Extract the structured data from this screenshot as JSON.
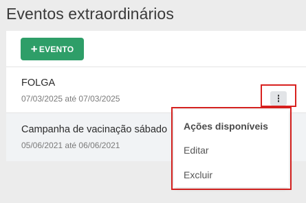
{
  "page": {
    "title": "Eventos extraordinários"
  },
  "toolbar": {
    "add_button_icon": "plus-icon",
    "add_button_label": "EVENTO",
    "accent_color": "#2e9e68"
  },
  "events": [
    {
      "name": "FOLGA",
      "dates": "07/03/2025 até 07/03/2025"
    },
    {
      "name": "Campanha de vacinação sábado",
      "dates": "05/06/2021 até 06/06/2021"
    }
  ],
  "actions_menu": {
    "trigger_icon": "kebab-menu-icon",
    "header": "Ações disponíveis",
    "items": [
      {
        "label": "Editar"
      },
      {
        "label": "Excluir"
      }
    ],
    "highlight_color": "#d8201e"
  }
}
